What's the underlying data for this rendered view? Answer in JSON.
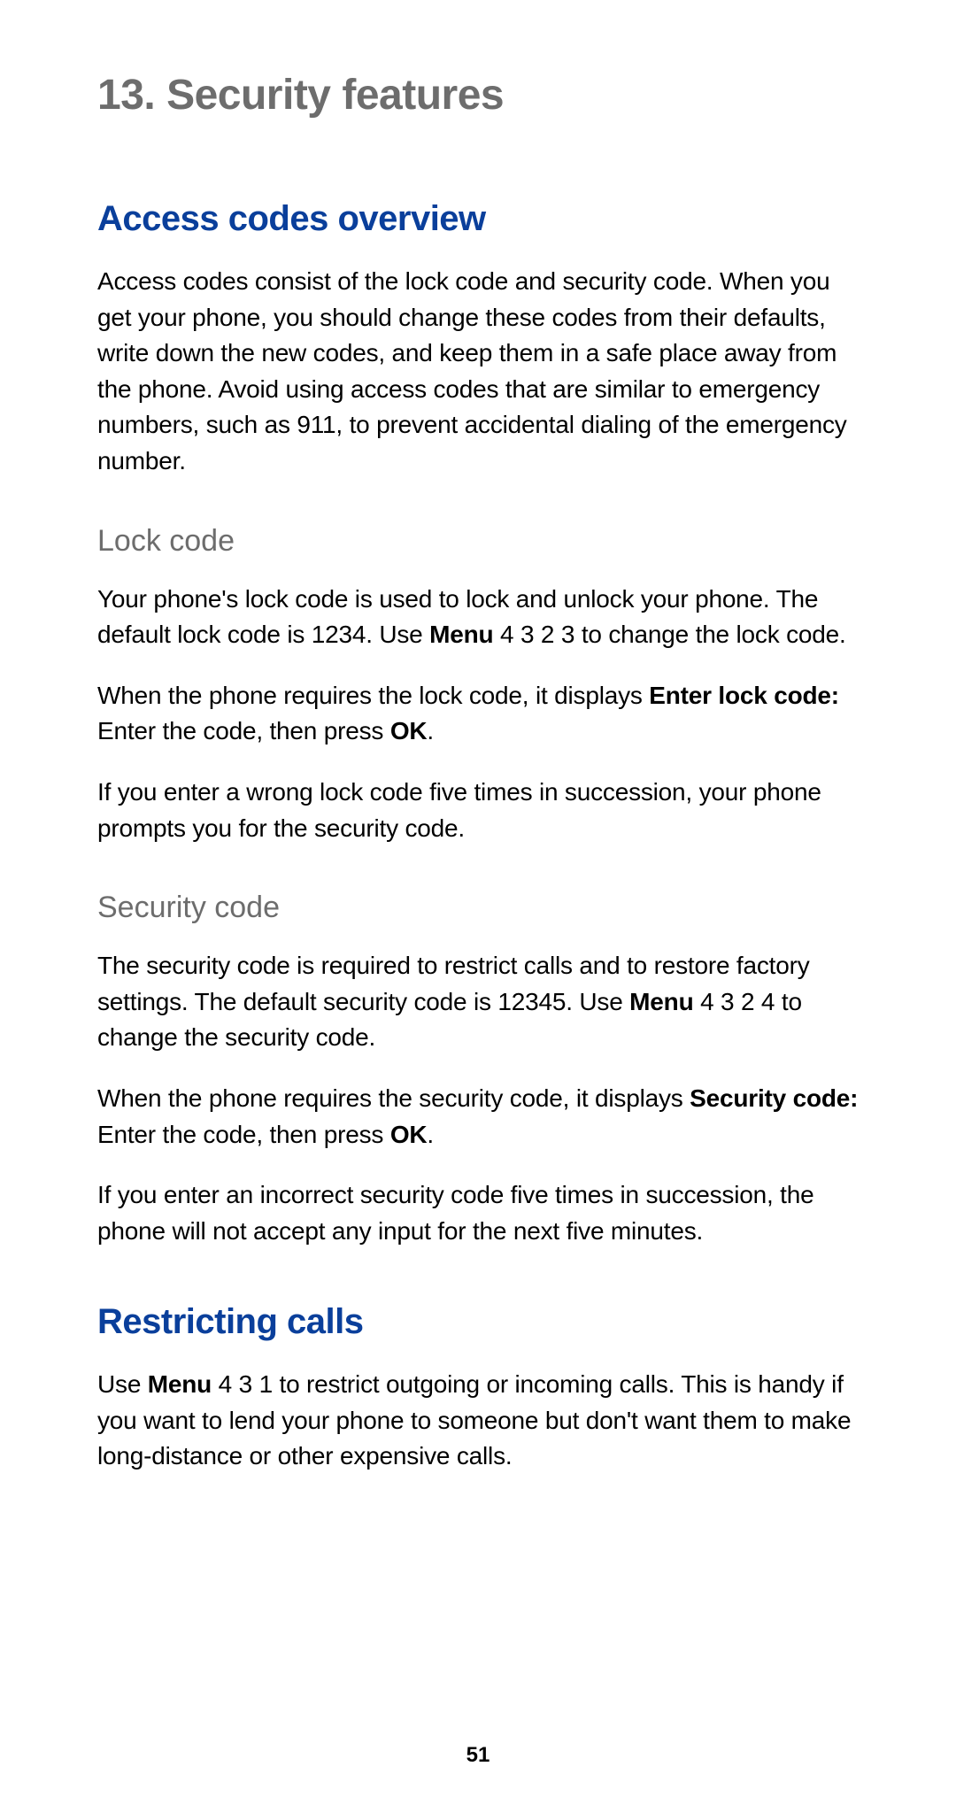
{
  "chapter": {
    "number": "13.",
    "title": "Security features"
  },
  "sections": {
    "access_codes": {
      "title": "Access codes overview",
      "intro": "Access codes consist of the lock code and security code. When you get your phone, you should change these codes from their defaults, write down the new codes, and keep them in a safe place away from the phone. Avoid using access codes that are similar to emergency numbers, such as 911, to prevent accidental dialing of the emergency number.",
      "lock_code": {
        "title": "Lock code",
        "p1_a": "Your phone's lock code is used to lock and unlock your phone. The default lock code is 1234. Use ",
        "p1_bold": "Menu",
        "p1_b": " 4 3 2 3 to change the lock code.",
        "p2_a": "When the phone requires the lock code, it displays ",
        "p2_bold1": "Enter lock code:",
        "p2_b": "  Enter the code, then press ",
        "p2_bold2": "OK",
        "p2_c": ".",
        "p3": "If you enter a wrong lock code five times in succession, your phone prompts you for the security code."
      },
      "security_code": {
        "title": "Security code",
        "p1_a": "The security code is required to restrict calls and to restore factory settings. The default security code is 12345. Use ",
        "p1_bold": "Menu",
        "p1_b": " 4 3 2 4 to change the security code.",
        "p2_a": "When the phone requires the security code, it displays ",
        "p2_bold1": "Security code:",
        "p2_b": "  Enter the code, then press ",
        "p2_bold2": "OK",
        "p2_c": ".",
        "p3": "If you enter an incorrect security code five times in succession, the phone will not accept any input for the next five minutes."
      }
    },
    "restricting_calls": {
      "title": "Restricting calls",
      "p1_a": "Use ",
      "p1_bold": "Menu",
      "p1_b": " 4 3 1 to restrict outgoing or incoming calls. This is handy if you want to lend your phone to someone but don't want them to make long-distance or other expensive calls."
    }
  },
  "page_number": "51"
}
